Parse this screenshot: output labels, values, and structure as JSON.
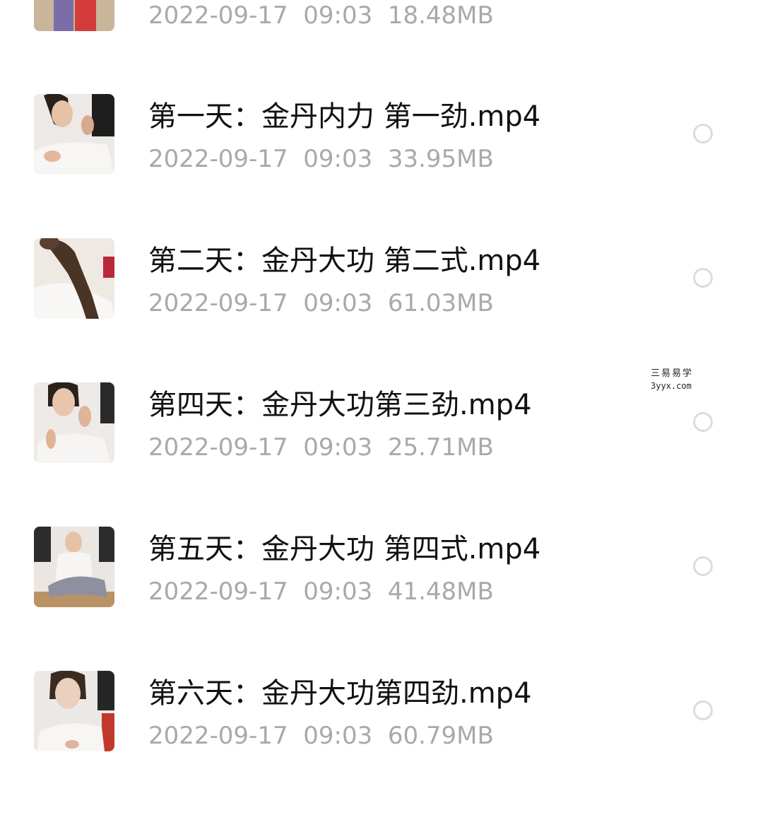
{
  "files": [
    {
      "name": "",
      "date": "2022-09-17",
      "time": "09:03",
      "size": "18.48MB",
      "thumbnail": "person-standing-thumbnail"
    },
    {
      "name": "第一天：金丹内力 第一劲.mp4",
      "date": "2022-09-17",
      "time": "09:03",
      "size": "33.95MB",
      "thumbnail": "woman-hand-to-face-thumbnail"
    },
    {
      "name": "第二天：金丹大功 第二式.mp4",
      "date": "2022-09-17",
      "time": "09:03",
      "size": "61.03MB",
      "thumbnail": "woman-long-hair-back-thumbnail"
    },
    {
      "name": "第四天：金丹大功第三劲.mp4",
      "date": "2022-09-17",
      "time": "09:03",
      "size": "25.71MB",
      "thumbnail": "woman-hands-raised-thumbnail"
    },
    {
      "name": "第五天：金丹大功 第四式.mp4",
      "date": "2022-09-17",
      "time": "09:03",
      "size": "41.48MB",
      "thumbnail": "woman-seated-stretch-thumbnail"
    },
    {
      "name": "第六天：金丹大功第四劲.mp4",
      "date": "2022-09-17",
      "time": "09:03",
      "size": "60.79MB",
      "thumbnail": "woman-eyes-closed-thumbnail"
    }
  ],
  "watermark": {
    "line1": "三易易学",
    "line2": "3yyx.com"
  },
  "colors": {
    "background": "#ffffff",
    "title_text": "#111111",
    "meta_text": "#a9a9ad",
    "radio_border": "#dcdcdc"
  }
}
